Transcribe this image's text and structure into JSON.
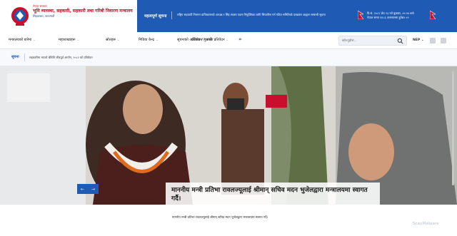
{
  "brand": {
    "gov": "नेपाल सरकार",
    "ministry": "भूमि व्यवस्था, सहकारी, सहकारी तथा गरिबी निवारण मन्त्रालय",
    "address": "सिंहदरबार, काठमाडौं"
  },
  "notice": {
    "title": "महत्वपूर्ण सूचना",
    "text": "राष्ट्रिय सहकारी नियमन प्राधिकरणको अध्यक्ष र सिंह सदस्य पदमा नियुक्तिका लागि सिफारिस गर्न गठित समितिको दरखास्त आह्वान सम्बन्धी सूचना",
    "date_line1": "वि.सं. २०८२ जेठ २३ गते बुधवार, ०५:२४ बजे",
    "date_line2": "नेपाल समय  १२८६ अन्तरालमा हुनेछ।  ०२"
  },
  "nav": {
    "items": [
      "मन्त्रालयको बारेमा",
      "महाशाखाहरू",
      "स्रोतहरू",
      "मिडिया केन्द्र",
      "सूचनाको अधिकार / गुनासो",
      "प्रतिवेदन / प्रगति प्रतिवेदन"
    ],
    "more": "»",
    "search_placeholder": "खोज्नुहोस...",
    "lang": "NEP"
  },
  "ticker": {
    "label": "सूचना",
    "text": "सहकारीमा भएको बेथिति जीवपूर्व आयोग, २०८२ को प्रतिवेदन"
  },
  "hero": {
    "caption": "माननीय मन्त्री प्रतिभा रावलज्यूलाई श्रीमान् सचिव मदन भुजेलद्वारा मन्त्रालयमा स्वागत गर्दै।",
    "subcaption": "माननीय मन्त्री प्रतिभा रावलज्यूलाई श्रीमान् सचिव मदन भुजेलद्वारा मन्त्रालयमा स्वागत गर्दै।",
    "prev": "←",
    "next": "→"
  },
  "watermark": "ScanMalware",
  "colors": {
    "brand_blue": "#1f5bb5",
    "brand_red": "#c8102e"
  }
}
